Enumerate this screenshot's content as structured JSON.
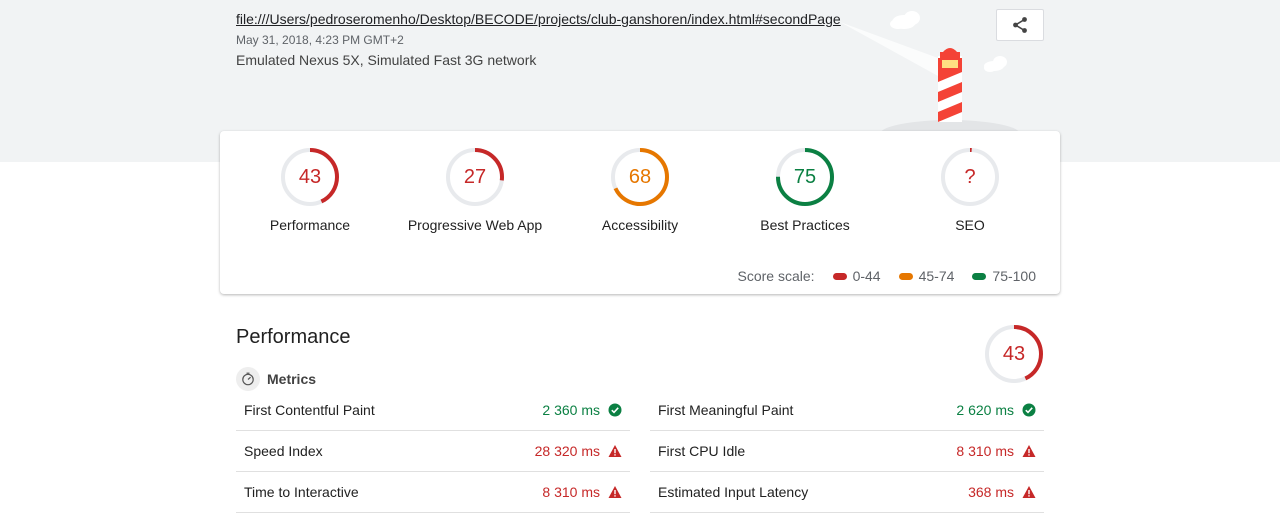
{
  "header": {
    "url": "file:///Users/pedroseromenho/Desktop/BECODE/projects/club-ganshoren/index.html#secondPage",
    "date": "May 31, 2018, 4:23 PM GMT+2",
    "environment": "Emulated Nexus 5X, Simulated Fast 3G network",
    "share_icon": "share-icon"
  },
  "colors": {
    "fail": "#c62828",
    "average": "#e67700",
    "pass": "#0b8043",
    "track": "#e8eaed",
    "unknown": "#c62828"
  },
  "gauges": [
    {
      "score": "43",
      "label": "Performance",
      "value": 43,
      "status": "fail"
    },
    {
      "score": "27",
      "label": "Progressive Web App",
      "value": 27,
      "status": "fail"
    },
    {
      "score": "68",
      "label": "Accessibility",
      "value": 68,
      "status": "average"
    },
    {
      "score": "75",
      "label": "Best Practices",
      "value": 75,
      "status": "pass"
    },
    {
      "score": "?",
      "label": "SEO",
      "value": 0,
      "status": "unknown"
    }
  ],
  "scale": {
    "label": "Score scale:",
    "items": [
      {
        "range": "0-44",
        "status": "fail"
      },
      {
        "range": "45-74",
        "status": "average"
      },
      {
        "range": "75-100",
        "status": "pass"
      }
    ]
  },
  "performance": {
    "title": "Performance",
    "score": "43",
    "value": 43,
    "metrics_label": "Metrics",
    "metrics_icon": "timer-icon",
    "metrics": [
      {
        "name": "First Contentful Paint",
        "value": "2 360 ms",
        "status": "pass",
        "icon": "check-circle-icon"
      },
      {
        "name": "First Meaningful Paint",
        "value": "2 620 ms",
        "status": "pass",
        "icon": "check-circle-icon"
      },
      {
        "name": "Speed Index",
        "value": "28 320 ms",
        "status": "fail",
        "icon": "warning-triangle-icon"
      },
      {
        "name": "First CPU Idle",
        "value": "8 310 ms",
        "status": "fail",
        "icon": "warning-triangle-icon"
      },
      {
        "name": "Time to Interactive",
        "value": "8 310 ms",
        "status": "fail",
        "icon": "warning-triangle-icon"
      },
      {
        "name": "Estimated Input Latency",
        "value": "368 ms",
        "status": "fail",
        "icon": "warning-triangle-icon"
      }
    ]
  }
}
